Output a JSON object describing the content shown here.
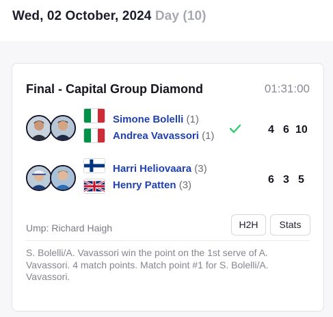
{
  "header": {
    "date": "Wed, 02 October, 2024",
    "day": "Day (10)"
  },
  "match": {
    "title": "Final - Capital Group Diamond",
    "elapsed": "01:31:00",
    "teams": [
      {
        "winner": true,
        "players": [
          {
            "name": "Simone Bolelli",
            "seed": "(1)",
            "flag": "italy-flag"
          },
          {
            "name": "Andrea Vavassori",
            "seed": "(1)",
            "flag": "italy-flag"
          }
        ],
        "scores": [
          "4",
          "6",
          "10"
        ]
      },
      {
        "winner": false,
        "players": [
          {
            "name": "Harri Heliovaara",
            "seed": "(3)",
            "flag": "finland-flag"
          },
          {
            "name": "Henry Patten",
            "seed": "(3)",
            "flag": "uk-flag"
          }
        ],
        "scores": [
          "6",
          "3",
          "5"
        ]
      }
    ],
    "umpire": "Ump: Richard Haigh",
    "buttons": {
      "h2h": "H2H",
      "stats": "Stats"
    },
    "commentary": "S. Bolelli/A. Vavassori win the point on the 1st serve of A. Vavassori. 4 match points. Match point #1 for S. Bolelli/A. Vavassori."
  },
  "colors": {
    "player_link": "#1f3fb5",
    "winner_check": "#2ecc71",
    "muted_text": "#858590"
  }
}
